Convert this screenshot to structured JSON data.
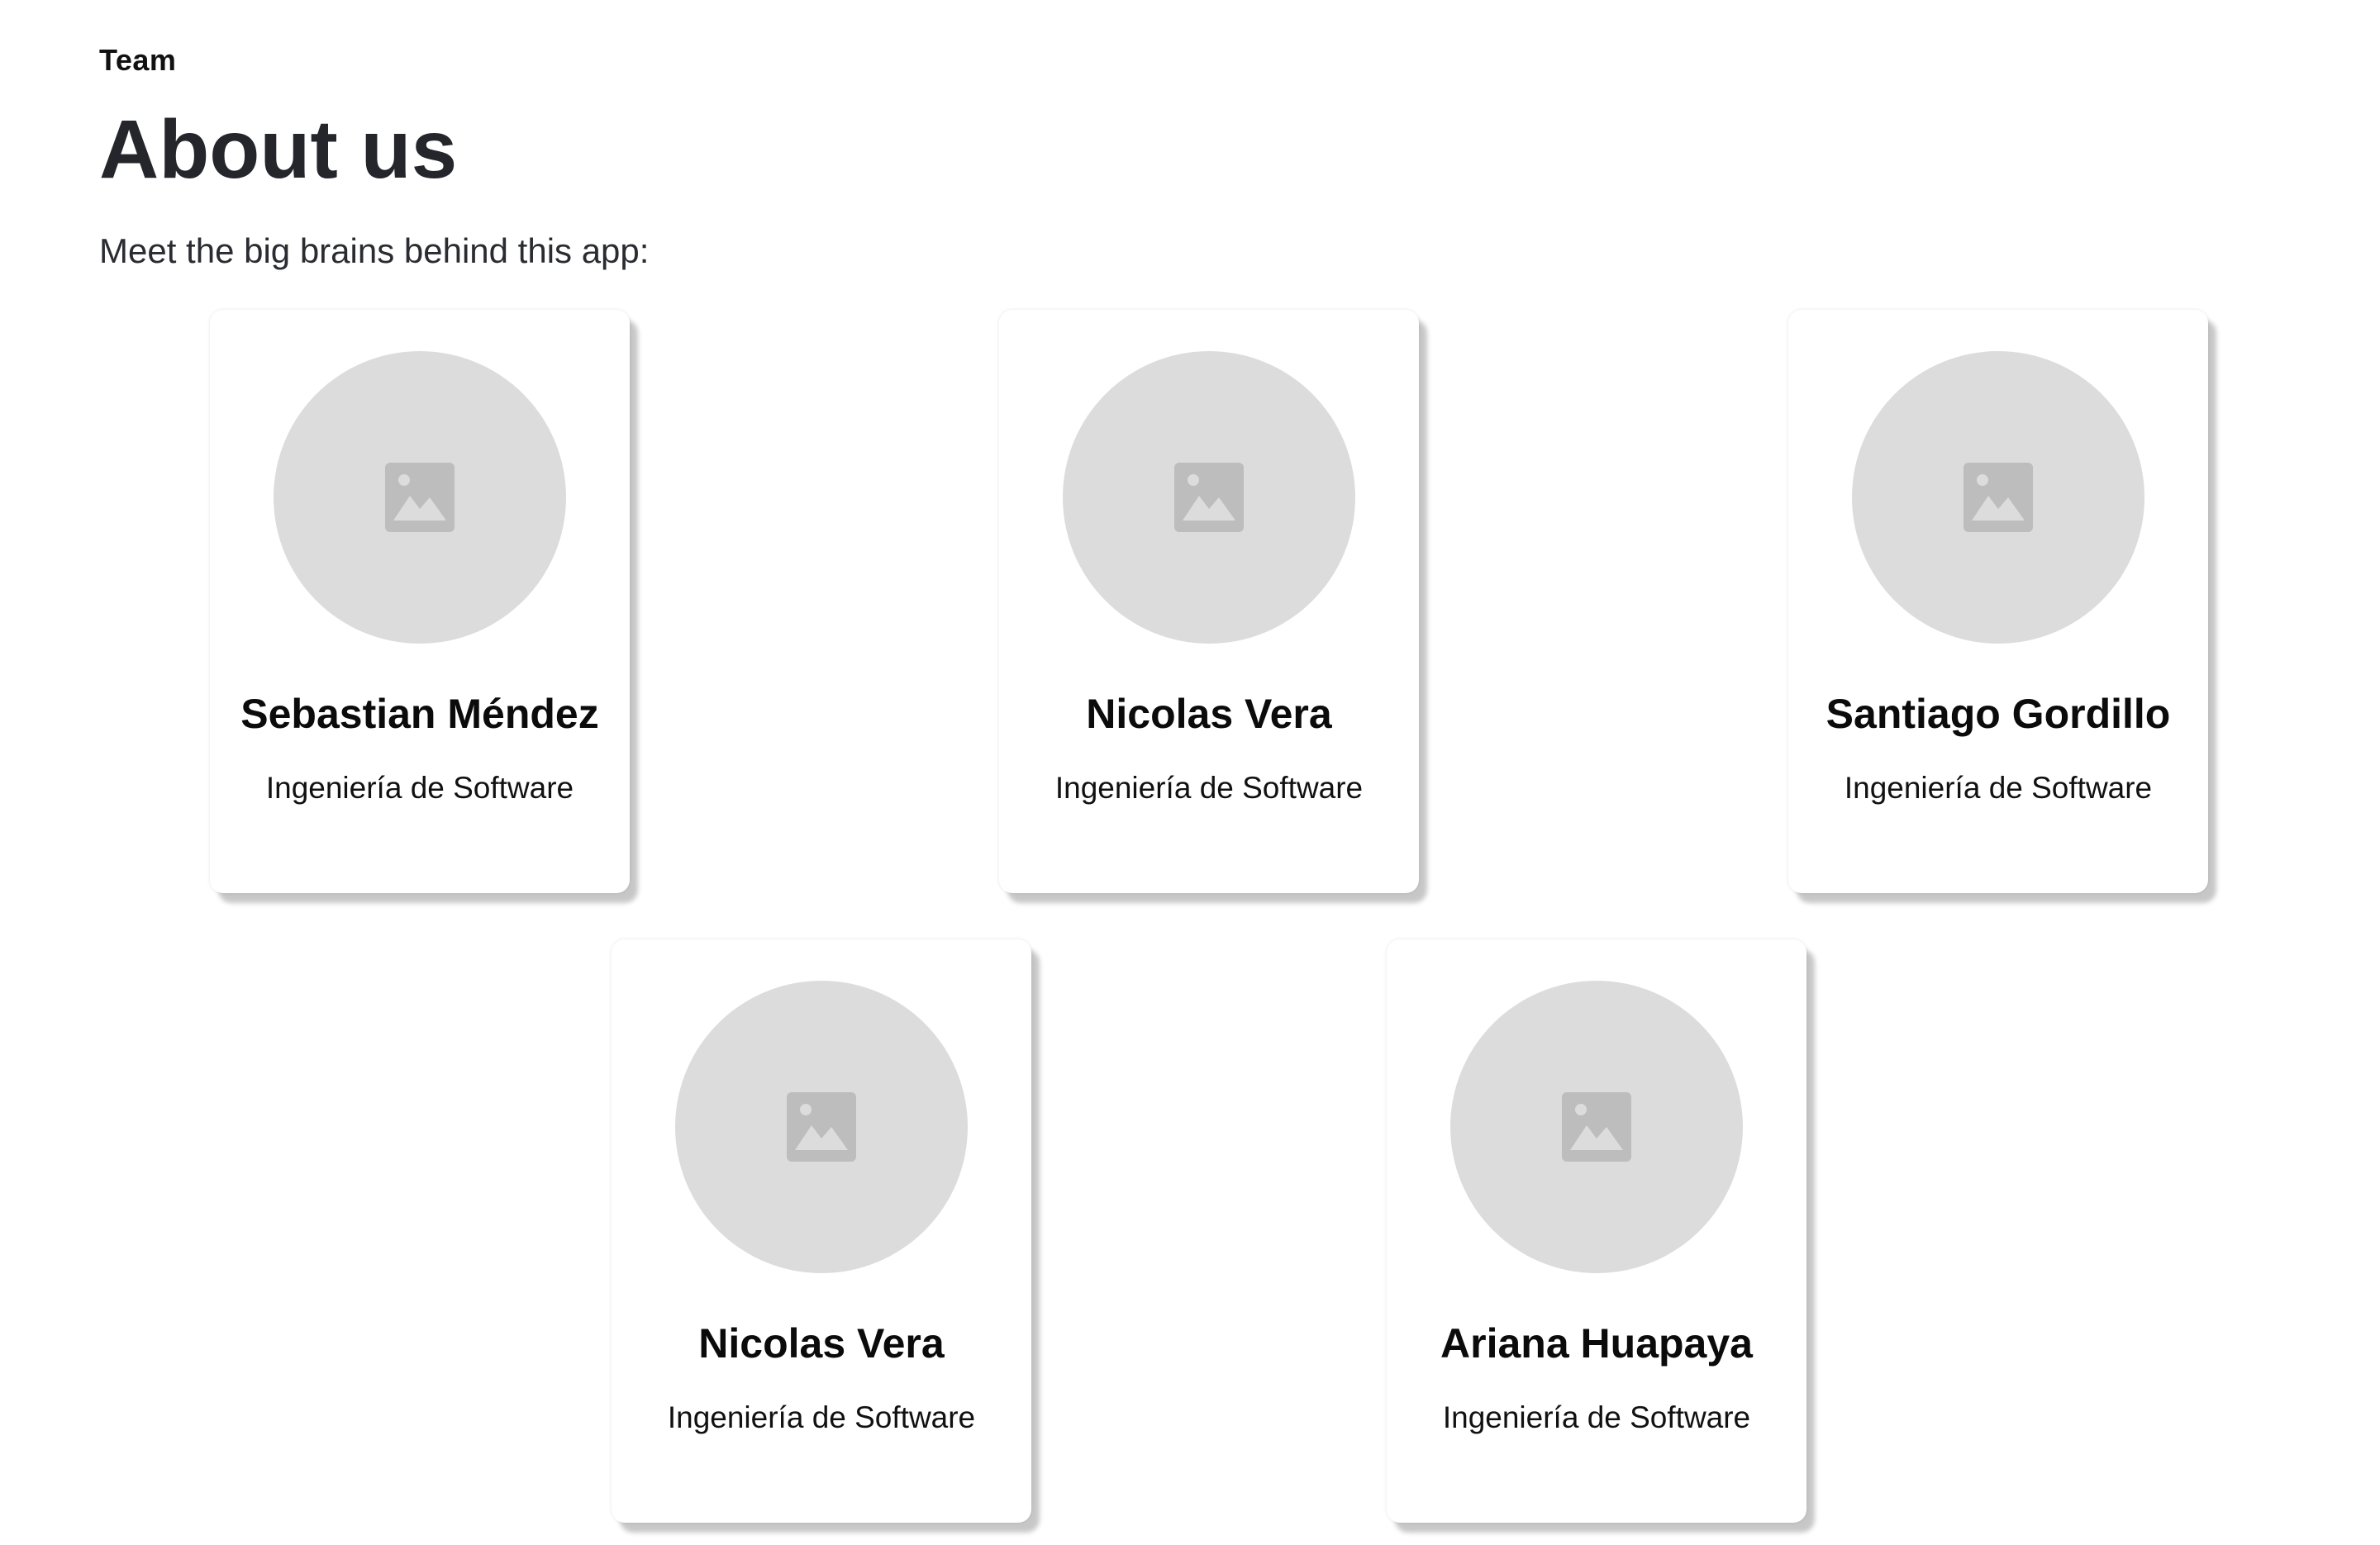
{
  "header": {
    "eyebrow": "Team",
    "title": "About us",
    "subtitle": "Meet the big brains behind this app:"
  },
  "members": [
    {
      "name": "Sebastian Méndez",
      "role": "Ingeniería de Software",
      "photo_icon": "image-placeholder-icon"
    },
    {
      "name": "Nicolas Vera",
      "role": "Ingeniería de Software",
      "photo_icon": "image-placeholder-icon"
    },
    {
      "name": "Santiago Gordillo",
      "role": "Ingeniería de Software",
      "photo_icon": "image-placeholder-icon"
    },
    {
      "name": "Nicolas Vera",
      "role": "Ingeniería de Software",
      "photo_icon": "image-placeholder-icon"
    },
    {
      "name": "Ariana Huapaya",
      "role": "Ingeniería de Software",
      "photo_icon": "image-placeholder-icon"
    }
  ],
  "colors": {
    "background": "#ffffff",
    "heading": "#24262b",
    "photo_placeholder": "#dcdcdc",
    "icon": "#bdbdbd"
  }
}
